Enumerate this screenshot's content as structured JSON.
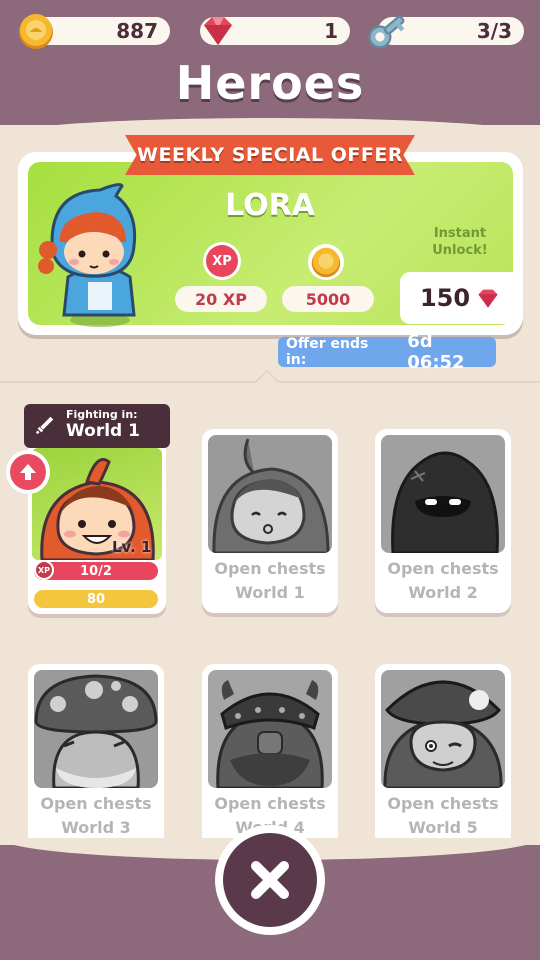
{
  "header": {
    "title": "Heroes",
    "coins": "887",
    "gems": "1",
    "keys": "3/3"
  },
  "offer": {
    "ribbon": "WEEKLY SPECIAL OFFER",
    "hero_name": "LORA",
    "xp_icon_label": "XP",
    "xp_reward": "20 XP",
    "coin_reward": "5000",
    "instant_line1": "Instant",
    "instant_line2": "Unlock!",
    "price": "150",
    "ends_label": "Offer ends in:",
    "ends_value": "6d 06:52"
  },
  "active_hero": {
    "fighting_label": "Fighting in:",
    "fighting_world": "World 1",
    "level": "Lv. 1",
    "xp_badge": "XP",
    "xp_progress": "10/2",
    "gold": "80"
  },
  "locked_heroes": [
    {
      "line1": "Open chests",
      "line2": "World 1"
    },
    {
      "line1": "Open chests",
      "line2": "World 2"
    },
    {
      "line1": "Open chests",
      "line2": "World 3"
    },
    {
      "line1": "Open chests",
      "line2": "World 4"
    },
    {
      "line1": "Open chests",
      "line2": "World 5"
    }
  ],
  "colors": {
    "accent_band": "#8c6a7c",
    "background": "#efe4d6",
    "offer_green": "#a6df3e",
    "ribbon": "#e8593a",
    "xp_red": "#e8465d",
    "gold": "#f4c63b"
  }
}
